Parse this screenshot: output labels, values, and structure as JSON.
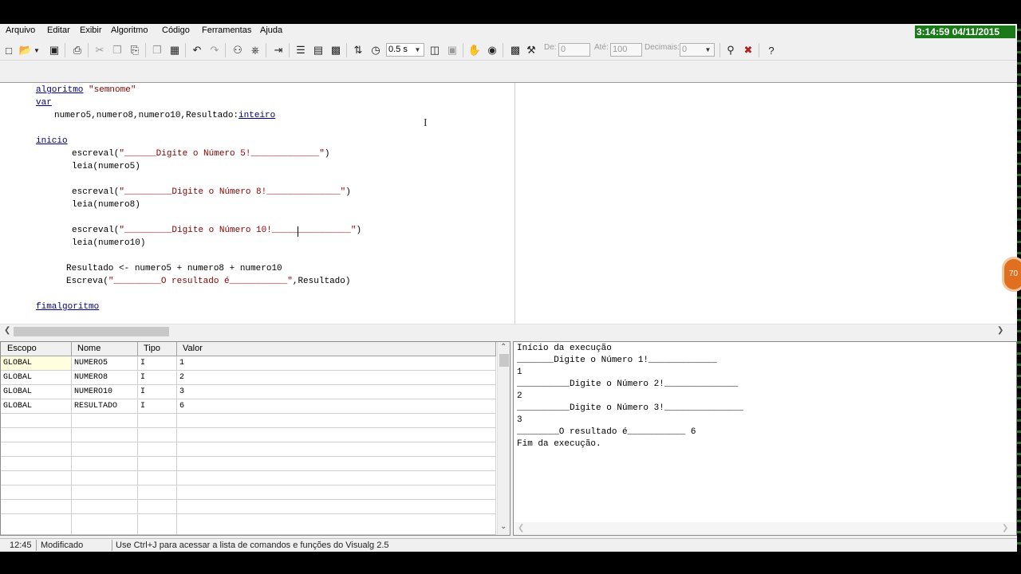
{
  "clock": "3:14:59  04/11/2015",
  "menu": [
    "Arquivo",
    "Editar",
    "Exibir",
    "Algoritmo",
    "Código",
    "Ferramentas",
    "Ajuda"
  ],
  "toolbar": {
    "speed_value": "0.5 s",
    "de_label": "De:",
    "de_value": "0",
    "ate_label": "Até:",
    "ate_value": "100",
    "decimais_label": "Decimais:",
    "decimais_value": "0"
  },
  "code": {
    "l1_kw": "algoritmo",
    "l1_str": "\"semnome\"",
    "l2_kw": "var",
    "l3_ids": "numero5,numero8,numero10,Resultado:",
    "l3_type": "inteiro",
    "l4_kw": "inicio",
    "l5_fn": "escreval(",
    "l5_str": "\"______Digite o Número 5!_____________\"",
    "l5_end": ")",
    "l6": "leia(numero5)",
    "l7_fn": "escreval(",
    "l7_str": "\"_________Digite o Número 8!______________\"",
    "l7_end": ")",
    "l8": "leia(numero8)",
    "l9_fn": "escreval(",
    "l9_str": "\"_________Digite o Número 10!_______________\"",
    "l9_end": ")",
    "l10": "leia(numero10)",
    "l11": "Resultado <- numero5 + numero8 + numero10",
    "l12_fn": "Escreva(",
    "l12_str": "\"_________O resultado é___________\"",
    "l12_end": ",Resultado)",
    "l13_kw": "fimalgoritmo"
  },
  "grid": {
    "headers": [
      "Escopo",
      "Nome",
      "Tipo",
      "Valor"
    ],
    "rows": [
      [
        "GLOBAL",
        "NUMERO5",
        "I",
        "1"
      ],
      [
        "GLOBAL",
        "NUMERO8",
        "I",
        "2"
      ],
      [
        "GLOBAL",
        "NUMERO10",
        "I",
        "3"
      ],
      [
        "GLOBAL",
        "RESULTADO",
        "I",
        "6"
      ]
    ]
  },
  "output": [
    "Início da execução",
    "_______Digite o Número 1!_____________",
    "1",
    "__________Digite o Número 2!______________",
    "2",
    "__________Digite o Número 3!_______________",
    "3",
    "________O resultado é___________ 6",
    "Fim da execução."
  ],
  "status": {
    "position": "12:45",
    "state": "Modificado",
    "hint": "Use Ctrl+J para acessar a lista de comandos e funções do Visualg 2.5"
  },
  "badge": "70",
  "colors": {
    "keyword": "#00008b",
    "string": "#8b0000",
    "clock_bg": "#1a7a1a"
  }
}
